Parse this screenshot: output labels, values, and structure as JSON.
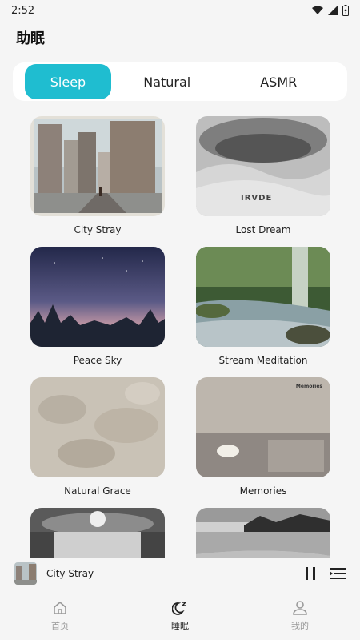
{
  "status_bar": {
    "time": "2:52"
  },
  "page_title": "助眠",
  "tabs": [
    {
      "label": "Sleep",
      "active": true
    },
    {
      "label": "Natural",
      "active": false
    },
    {
      "label": "ASMR",
      "active": false
    }
  ],
  "accent_color": "#1fbdd0",
  "cards": [
    {
      "title": "City Stray"
    },
    {
      "title": "Lost Dream",
      "art_text": "IRVDE"
    },
    {
      "title": "Peace Sky"
    },
    {
      "title": "Stream Meditation"
    },
    {
      "title": "Natural Grace"
    },
    {
      "title": "Memories",
      "art_text": "Memories"
    },
    {
      "title": ""
    },
    {
      "title": ""
    }
  ],
  "mini_player": {
    "title": "City Stray",
    "pause_icon": "pause-icon",
    "playlist_icon": "playlist-icon"
  },
  "bottom_nav": [
    {
      "label": "首页",
      "icon": "home-icon",
      "active": false
    },
    {
      "label": "睡眠",
      "icon": "moon-icon",
      "active": true
    },
    {
      "label": "我的",
      "icon": "user-icon",
      "active": false
    }
  ]
}
